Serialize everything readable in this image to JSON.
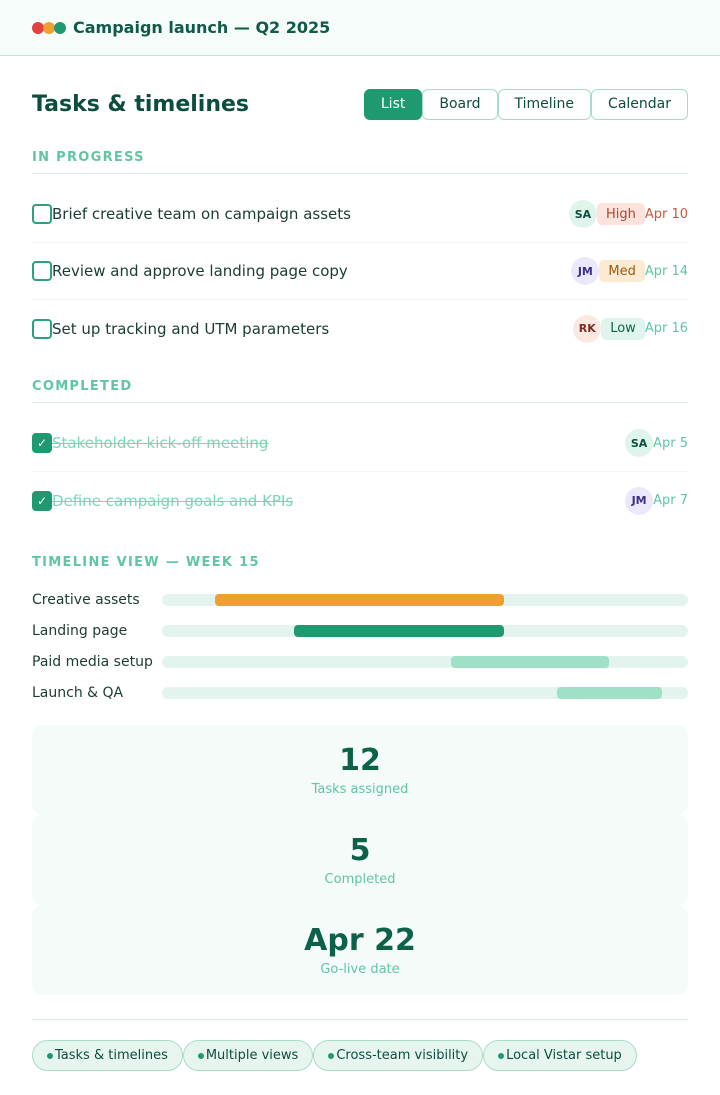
{
  "app": {
    "title": "Campaign launch — Q2 2025",
    "dots": [
      "#e0413f",
      "#f0a030",
      "#1f9a70"
    ]
  },
  "header": {
    "title": "Tasks & timelines",
    "tabs": [
      {
        "label": "List",
        "active": true
      },
      {
        "label": "Board",
        "active": false
      },
      {
        "label": "Timeline",
        "active": false
      },
      {
        "label": "Calendar",
        "active": false
      }
    ]
  },
  "in_progress": {
    "label": "IN PROGRESS",
    "tasks": [
      {
        "name": "Brief creative team on campaign assets",
        "assignee": "SA",
        "priority": "High",
        "due": "Apr 10"
      },
      {
        "name": "Review and approve landing page copy",
        "assignee": "JM",
        "priority": "Med",
        "due": "Apr 14"
      },
      {
        "name": "Set up tracking and UTM parameters",
        "assignee": "RK",
        "priority": "Low",
        "due": "Apr 16"
      }
    ]
  },
  "completed": {
    "label": "COMPLETED",
    "tasks": [
      {
        "name": "Stakeholder kick-off meeting",
        "assignee": "SA",
        "due": "Apr 5"
      },
      {
        "name": "Define campaign goals and KPIs",
        "assignee": "JM",
        "due": "Apr 7"
      }
    ]
  },
  "timeline": {
    "label": "TIMELINE VIEW — WEEK 15",
    "rows": [
      {
        "label": "Creative assets",
        "start_fraction": 0.1,
        "end_fraction": 0.65,
        "color": "#f0a030"
      },
      {
        "label": "Landing page",
        "start_fraction": 0.25,
        "end_fraction": 0.65,
        "color": "#1f9a70"
      },
      {
        "label": "Paid media setup",
        "start_fraction": 0.55,
        "end_fraction": 0.85,
        "color": "#9fe0c6"
      },
      {
        "label": "Launch & QA",
        "start_fraction": 0.75,
        "end_fraction": 0.95,
        "color": "#9fe0c6"
      }
    ]
  },
  "stats": [
    {
      "value": "12",
      "label": "Tasks assigned"
    },
    {
      "value": "5",
      "label": "Completed"
    },
    {
      "value": "Apr 22",
      "label": "Go-live date"
    }
  ],
  "chips": [
    "Tasks & timelines",
    "Multiple views",
    "Cross-team visibility",
    "Local Vistar setup"
  ],
  "colors": {
    "accent": "#1f9a70",
    "avatar_SA": "#dff5ec",
    "avatar_JM": "#ece8fb",
    "avatar_RK": "#fbe8e3",
    "prio_high_bg": "#fde3dc",
    "prio_med_bg": "#fcebd2",
    "prio_low_bg": "#dff5ec"
  },
  "icons": {
    "checkbox_checked": "check-icon"
  }
}
